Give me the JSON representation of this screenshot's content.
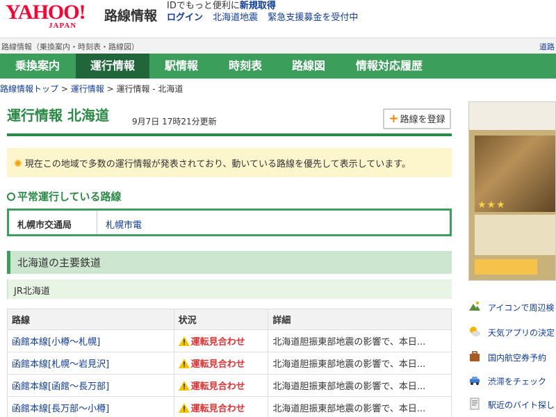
{
  "header": {
    "logo_main": "YAHOO!",
    "logo_sub": "JAPAN",
    "site_name": "路線情報",
    "promo_text": "IDでもっと便利に",
    "promo_link": "新規取得",
    "login": "ログイン",
    "news_1": "北海道地震",
    "news_2": "緊急支援募金を受付中"
  },
  "subbar": {
    "left": "路線情報（乗換案内・時刻表・路線図）",
    "right": "道路"
  },
  "nav": {
    "items": [
      {
        "label": "乗換案内"
      },
      {
        "label": "運行情報"
      },
      {
        "label": "駅情報"
      },
      {
        "label": "時刻表"
      },
      {
        "label": "路線図"
      },
      {
        "label": "情報対応履歴"
      }
    ],
    "active_index": 1
  },
  "breadcrumb": {
    "top": "路線情報トップ",
    "sep": ">",
    "ops": "運行情報",
    "current": "運行情報 - 北海道"
  },
  "main": {
    "title": "運行情報 北海道",
    "updated": "9月7日 17時21分更新",
    "register_label": "路線を登録",
    "notice": "現在この地域で多数の運行情報が発表されており、動いている路線を優先して表示しています。",
    "normal_heading": "平常運行している路線",
    "normal_operator": "札幌市交通局",
    "normal_line": "札幌市電",
    "band": "北海道の主要鉄道",
    "company": "JR北海道",
    "table": {
      "headers": [
        "路線",
        "状況",
        "詳細"
      ],
      "rows": [
        {
          "line": "函館本線[小樽〜札幌]",
          "status": "運転見合わせ",
          "detail": "北海道胆振東部地震の影響で、本日..."
        },
        {
          "line": "函館本線[札幌〜岩見沢]",
          "status": "運転見合わせ",
          "detail": "北海道胆振東部地震の影響で、本日..."
        },
        {
          "line": "函館本線[函館〜長万部]",
          "status": "運転見合わせ",
          "detail": "北海道胆振東部地震の影響で、本日..."
        },
        {
          "line": "函館本線[長万部〜小樽]",
          "status": "運転見合わせ",
          "detail": "北海道胆振東部地震の影響で、本日..."
        }
      ]
    }
  },
  "sidebar": {
    "links": [
      {
        "label": "アイコンで周辺検",
        "icon": "mountain-icon"
      },
      {
        "label": "天気アプリの決定",
        "icon": "weather-icon"
      },
      {
        "label": "国内航空券予約",
        "icon": "suitcase-icon"
      },
      {
        "label": "渋滞をチェック",
        "icon": "car-icon"
      },
      {
        "label": "駅近のバイト探し",
        "icon": "document-icon"
      }
    ]
  },
  "colors": {
    "brand_green": "#3b9f5b",
    "dark_green": "#21663a",
    "title_green": "#2a8a45",
    "link_blue": "#0f3c9a",
    "alert_red": "#e03030",
    "yahoo_red": "#ff0033"
  }
}
